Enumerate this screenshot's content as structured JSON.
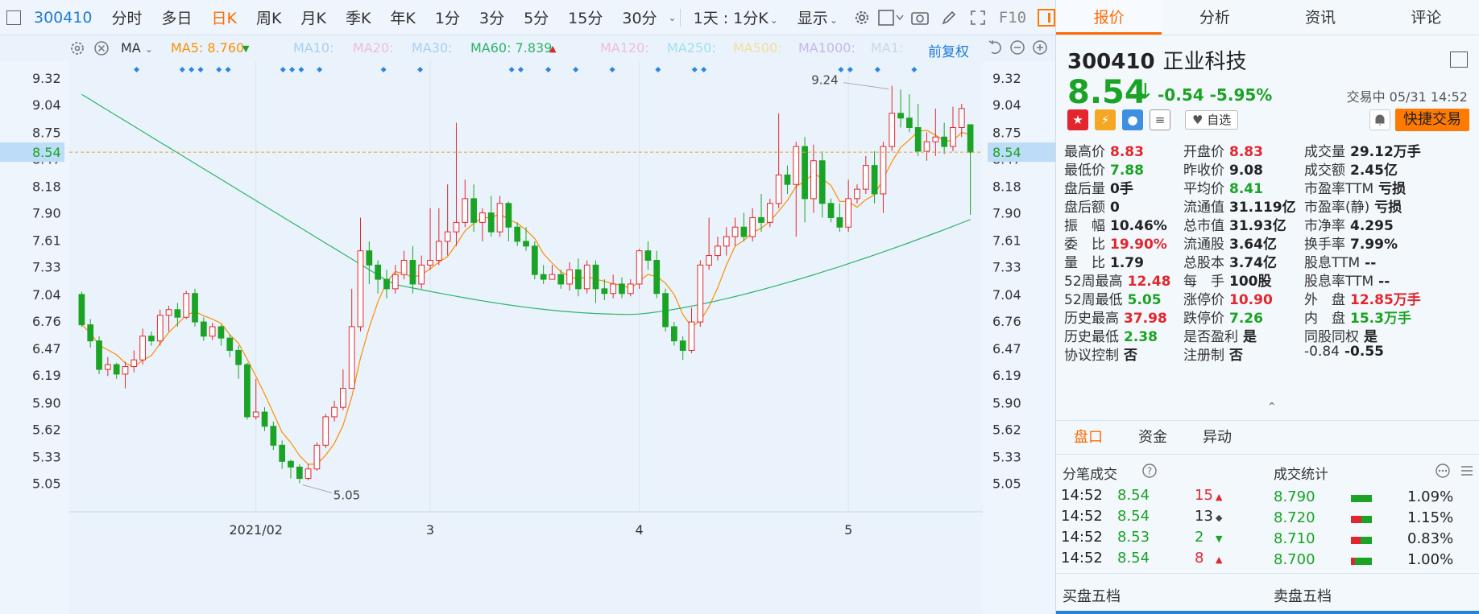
{
  "toolbar": {
    "code": "300410",
    "periods": [
      "分时",
      "多日",
      "日K",
      "周K",
      "月K",
      "季K",
      "年K",
      "1分",
      "3分",
      "5分",
      "15分",
      "30分"
    ],
    "active_period": "日K",
    "range_label": "1天 : 1分K",
    "display_label": "显示",
    "f10_label": "F10"
  },
  "indicators": {
    "type": "MA",
    "ma5": "MA5: 8.760",
    "ma10": "MA10:",
    "ma20": "MA20:",
    "ma30": "MA30:",
    "ma60": "MA60: 7.839",
    "ma120": "MA120:",
    "ma250": "MA250:",
    "ma500": "MA500:",
    "ma1000": "MA1000:",
    "ma1": "MA1:",
    "adjust": "前复权"
  },
  "chart_data": {
    "type": "candlestick",
    "y_ticks": [
      "9.32",
      "9.04",
      "8.75",
      "8.47",
      "8.18",
      "7.90",
      "7.61",
      "7.33",
      "7.04",
      "6.76",
      "6.47",
      "6.19",
      "5.90",
      "5.62",
      "5.33",
      "5.05"
    ],
    "ylim": [
      4.85,
      9.5
    ],
    "x_labels": [
      "2021/02",
      "3",
      "4",
      "5"
    ],
    "current_price": "8.54",
    "annotations": {
      "high": "9.24",
      "low": "5.05"
    },
    "candles": [
      [
        7.04,
        6.72,
        7.07,
        6.7
      ],
      [
        6.72,
        6.55,
        6.78,
        6.48
      ],
      [
        6.55,
        6.25,
        6.6,
        6.2
      ],
      [
        6.25,
        6.3,
        6.38,
        6.18
      ],
      [
        6.3,
        6.2,
        6.32,
        6.15
      ],
      [
        6.2,
        6.28,
        6.33,
        6.05
      ],
      [
        6.28,
        6.35,
        6.45,
        6.22
      ],
      [
        6.35,
        6.6,
        6.68,
        6.3
      ],
      [
        6.6,
        6.55,
        6.65,
        6.5
      ],
      [
        6.55,
        6.82,
        6.88,
        6.5
      ],
      [
        6.82,
        6.88,
        6.92,
        6.65
      ],
      [
        6.88,
        6.8,
        6.95,
        6.7
      ],
      [
        6.8,
        7.05,
        7.08,
        6.78
      ],
      [
        7.05,
        6.75,
        7.1,
        6.7
      ],
      [
        6.75,
        6.6,
        6.8,
        6.55
      ],
      [
        6.6,
        6.7,
        6.74,
        6.56
      ],
      [
        6.7,
        6.58,
        6.72,
        6.5
      ],
      [
        6.58,
        6.45,
        6.62,
        6.38
      ],
      [
        6.45,
        6.3,
        6.5,
        6.15
      ],
      [
        6.3,
        5.75,
        6.32,
        5.72
      ],
      [
        5.75,
        5.8,
        6.15,
        5.72
      ],
      [
        5.8,
        5.65,
        5.85,
        5.6
      ],
      [
        5.65,
        5.45,
        5.7,
        5.4
      ],
      [
        5.45,
        5.28,
        5.5,
        5.2
      ],
      [
        5.28,
        5.22,
        5.3,
        5.1
      ],
      [
        5.22,
        5.1,
        5.25,
        5.05
      ],
      [
        5.1,
        5.2,
        5.25,
        5.08
      ],
      [
        5.2,
        5.45,
        5.48,
        5.18
      ],
      [
        5.45,
        5.75,
        5.78,
        5.42
      ],
      [
        5.75,
        5.85,
        5.92,
        5.7
      ],
      [
        5.85,
        6.05,
        6.25,
        5.82
      ],
      [
        6.05,
        6.7,
        7.1,
        6.6
      ],
      [
        6.7,
        7.5,
        7.85,
        6.65
      ],
      [
        7.5,
        7.35,
        7.6,
        7.15
      ],
      [
        7.35,
        7.2,
        7.4,
        7.05
      ],
      [
        7.2,
        7.1,
        7.3,
        7.0
      ],
      [
        7.1,
        7.25,
        7.35,
        7.05
      ],
      [
        7.25,
        7.4,
        7.5,
        7.2
      ],
      [
        7.4,
        7.15,
        7.55,
        7.05
      ],
      [
        7.15,
        7.35,
        7.45,
        7.1
      ],
      [
        7.35,
        7.4,
        7.95,
        7.3
      ],
      [
        7.4,
        7.6,
        7.95,
        7.35
      ],
      [
        7.6,
        7.7,
        8.2,
        7.45
      ],
      [
        7.7,
        7.8,
        8.85,
        7.55
      ],
      [
        7.8,
        8.05,
        8.25,
        7.75
      ],
      [
        8.05,
        7.8,
        8.2,
        7.7
      ],
      [
        7.8,
        7.9,
        7.95,
        7.6
      ],
      [
        7.9,
        7.7,
        8.08,
        7.65
      ],
      [
        7.7,
        8.0,
        8.08,
        7.65
      ],
      [
        8.0,
        7.75,
        8.02,
        7.6
      ],
      [
        7.75,
        7.6,
        7.8,
        7.55
      ],
      [
        7.6,
        7.55,
        7.75,
        7.5
      ],
      [
        7.55,
        7.25,
        7.6,
        7.2
      ],
      [
        7.25,
        7.2,
        7.35,
        7.15
      ],
      [
        7.2,
        7.25,
        7.35,
        7.2
      ],
      [
        7.25,
        7.15,
        7.3,
        7.1
      ],
      [
        7.15,
        7.3,
        7.38,
        7.08
      ],
      [
        7.3,
        7.1,
        7.42,
        7.02
      ],
      [
        7.1,
        7.35,
        7.4,
        7.05
      ],
      [
        7.35,
        7.1,
        7.4,
        6.95
      ],
      [
        7.1,
        7.05,
        7.2,
        6.98
      ],
      [
        7.05,
        7.15,
        7.25,
        7.0
      ],
      [
        7.15,
        7.05,
        7.22,
        7.0
      ],
      [
        7.05,
        7.15,
        7.2,
        7.02
      ],
      [
        7.15,
        7.5,
        7.52,
        7.1
      ],
      [
        7.5,
        7.4,
        7.6,
        7.3
      ],
      [
        7.4,
        7.05,
        7.5,
        7.0
      ],
      [
        7.05,
        6.7,
        7.1,
        6.65
      ],
      [
        6.7,
        6.55,
        6.75,
        6.5
      ],
      [
        6.55,
        6.45,
        6.6,
        6.35
      ],
      [
        6.45,
        6.75,
        6.9,
        6.42
      ],
      [
        6.75,
        7.35,
        7.4,
        6.7
      ],
      [
        7.35,
        7.45,
        7.85,
        7.3
      ],
      [
        7.45,
        7.55,
        7.65,
        7.4
      ],
      [
        7.55,
        7.65,
        7.75,
        7.45
      ],
      [
        7.65,
        7.75,
        7.85,
        7.55
      ],
      [
        7.75,
        7.65,
        7.9,
        7.6
      ],
      [
        7.65,
        7.85,
        7.95,
        7.6
      ],
      [
        7.85,
        7.8,
        8.1,
        7.7
      ],
      [
        7.8,
        8.0,
        8.05,
        7.75
      ],
      [
        8.0,
        8.3,
        8.95,
        7.95
      ],
      [
        8.3,
        8.2,
        8.4,
        8.1
      ],
      [
        8.2,
        8.6,
        8.65,
        7.65
      ],
      [
        8.6,
        8.05,
        8.7,
        7.8
      ],
      [
        8.05,
        8.45,
        8.62,
        7.9
      ],
      [
        8.45,
        8.0,
        8.55,
        7.85
      ],
      [
        8.0,
        7.85,
        8.05,
        7.8
      ],
      [
        7.85,
        7.75,
        8.0,
        7.7
      ],
      [
        7.75,
        8.05,
        8.25,
        7.7
      ],
      [
        8.05,
        8.15,
        8.2,
        8.0
      ],
      [
        8.15,
        8.4,
        8.5,
        8.1
      ],
      [
        8.4,
        8.1,
        8.55,
        8.0
      ],
      [
        8.1,
        8.6,
        8.65,
        7.9
      ],
      [
        8.6,
        8.95,
        9.24,
        8.55
      ],
      [
        8.95,
        8.9,
        9.2,
        8.8
      ],
      [
        8.9,
        8.8,
        9.15,
        8.75
      ],
      [
        8.8,
        8.55,
        9.05,
        8.5
      ],
      [
        8.55,
        8.65,
        8.75,
        8.45
      ],
      [
        8.65,
        8.7,
        9.0,
        8.5
      ],
      [
        8.7,
        8.6,
        8.85,
        8.52
      ],
      [
        8.6,
        8.8,
        9.02,
        8.55
      ],
      [
        8.8,
        9.0,
        9.05,
        8.7
      ],
      [
        8.83,
        8.54,
        8.83,
        7.88
      ]
    ]
  },
  "panel": {
    "tabs": [
      "报价",
      "分析",
      "资讯",
      "评论"
    ],
    "active_tab": "报价",
    "code": "300410",
    "name": "正业科技",
    "price": "8.54",
    "change": "-0.54",
    "change_pct": "-5.95%",
    "status": "交易中 05/31 14:52",
    "favorite_label": "自选",
    "trade_label": "快捷交易",
    "quote_rows": [
      [
        {
          "l": "最高价",
          "v": "8.83",
          "c": "red"
        },
        {
          "l": "开盘价",
          "v": "8.83",
          "c": "red"
        },
        {
          "l": "成交量",
          "v": "29.12万手",
          "c": "dark"
        }
      ],
      [
        {
          "l": "最低价",
          "v": "7.88",
          "c": "green"
        },
        {
          "l": "昨收价",
          "v": "9.08",
          "c": "dark"
        },
        {
          "l": "成交额",
          "v": "2.45亿",
          "c": "dark"
        }
      ],
      [
        {
          "l": "盘后量",
          "v": "0手",
          "c": "dark"
        },
        {
          "l": "平均价",
          "v": "8.41",
          "c": "green"
        },
        {
          "l": "市盈率TTM",
          "v": "亏损",
          "c": "dark"
        }
      ],
      [
        {
          "l": "盘后额",
          "v": "0",
          "c": "dark"
        },
        {
          "l": "流通值",
          "v": "31.119亿",
          "c": "dark"
        },
        {
          "l": "市盈率(静)",
          "v": "亏损",
          "c": "dark"
        }
      ],
      [
        {
          "l": "振　幅",
          "v": "10.46%",
          "c": "dark"
        },
        {
          "l": "总市值",
          "v": "31.93亿",
          "c": "dark"
        },
        {
          "l": "市净率",
          "v": "4.295",
          "c": "dark"
        }
      ],
      [
        {
          "l": "委　比",
          "v": "19.90%",
          "c": "red"
        },
        {
          "l": "流通股",
          "v": "3.64亿",
          "c": "dark"
        },
        {
          "l": "换手率",
          "v": "7.99%",
          "c": "dark"
        }
      ],
      [
        {
          "l": "量　比",
          "v": "1.79",
          "c": "dark"
        },
        {
          "l": "总股本",
          "v": "3.74亿",
          "c": "dark"
        },
        {
          "l": "股息TTM",
          "v": "--",
          "c": "dark"
        }
      ],
      [
        {
          "l": "52周最高",
          "v": "12.48",
          "c": "red"
        },
        {
          "l": "每　手",
          "v": "100股",
          "c": "dark"
        },
        {
          "l": "股息率TTM",
          "v": "--",
          "c": "dark"
        }
      ],
      [
        {
          "l": "52周最低",
          "v": "5.05",
          "c": "green"
        },
        {
          "l": "涨停价",
          "v": "10.90",
          "c": "red"
        },
        {
          "l": "外　盘",
          "v": "12.85万手",
          "c": "red"
        }
      ],
      [
        {
          "l": "历史最高",
          "v": "37.98",
          "c": "red"
        },
        {
          "l": "跌停价",
          "v": "7.26",
          "c": "green"
        },
        {
          "l": "内　盘",
          "v": "15.3万手",
          "c": "green"
        }
      ],
      [
        {
          "l": "历史最低",
          "v": "2.38",
          "c": "green"
        },
        {
          "l": "是否盈利",
          "v": "是",
          "c": "dark"
        },
        {
          "l": "同股同权",
          "v": "是",
          "c": "dark"
        }
      ],
      [
        {
          "l": "协议控制",
          "v": "否",
          "c": "dark"
        },
        {
          "l": "注册制",
          "v": "否",
          "c": "dark"
        },
        {
          "l": "-0.84",
          "v": "-0.55",
          "c": "dark"
        }
      ]
    ],
    "sub_tabs": [
      "盘口",
      "资金",
      "异动"
    ],
    "active_sub": "盘口",
    "ticks_title": "分笔成交",
    "stats_title": "成交统计",
    "ticks": [
      {
        "time": "14:52",
        "price": "8.54",
        "vol": "15",
        "dir": "up"
      },
      {
        "time": "14:52",
        "price": "8.54",
        "vol": "13",
        "dir": "flat"
      },
      {
        "time": "14:52",
        "price": "8.53",
        "vol": "2",
        "dir": "down"
      },
      {
        "time": "14:52",
        "price": "8.54",
        "vol": "8",
        "dir": "up"
      }
    ],
    "stats": [
      {
        "price": "8.790",
        "pct": "1.09%",
        "red": 0.0,
        "green": 1.0
      },
      {
        "price": "8.720",
        "pct": "1.15%",
        "red": 0.5,
        "green": 0.5
      },
      {
        "price": "8.710",
        "pct": "0.83%",
        "red": 0.45,
        "green": 0.55
      },
      {
        "price": "8.700",
        "pct": "1.00%",
        "red": 0.2,
        "green": 0.8
      }
    ],
    "buy_label": "买盘五档",
    "sell_label": "卖盘五档"
  },
  "colors": {
    "up": "#e3262d",
    "down": "#1aa324",
    "ma5": "#ff8c00",
    "ma60": "#2db36b",
    "accent": "#ff6a00"
  }
}
